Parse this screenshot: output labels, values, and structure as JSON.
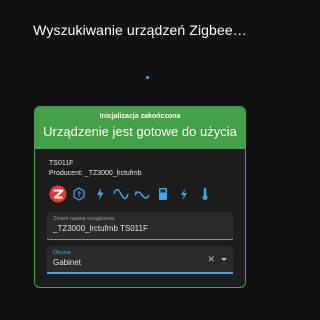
{
  "header": {
    "title": "Wyszukiwanie urządzeń Zigbee…"
  },
  "card": {
    "status": "Inicjalizacja zakończona",
    "headline": "Urządzenie jest gotowe do użycia",
    "accent_color": "#43a047",
    "device": {
      "model": "TS011F",
      "producer": "Producent: _TZ3000_lrctufmb"
    },
    "icons": [
      "zigbee-logo-icon",
      "help-badge-icon",
      "flash-icon",
      "sine-wave-icon",
      "current-wave-icon",
      "meter-icon",
      "power-icon",
      "thermometer-icon"
    ],
    "rename_field": {
      "label": "Zmień nazwę urządzenia",
      "value": "_TZ3000_lrctufmb TS011F"
    },
    "area_field": {
      "label": "Obszar",
      "value": "Gabinet",
      "focus_color": "#3ea7e8"
    }
  }
}
